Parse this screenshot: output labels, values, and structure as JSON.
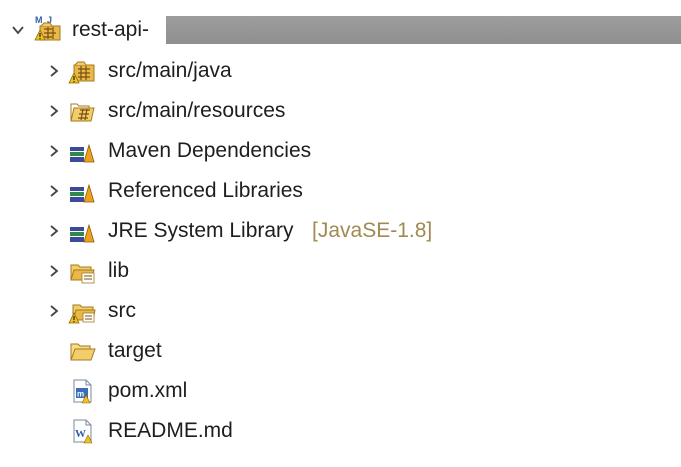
{
  "project": {
    "name": "rest-api-",
    "expanded": true
  },
  "items": [
    {
      "label": "src/main/java",
      "icon": "java-source-folder-icon",
      "expandable": true
    },
    {
      "label": "src/main/resources",
      "icon": "resource-folder-icon",
      "expandable": true
    },
    {
      "label": "Maven Dependencies",
      "icon": "library-icon",
      "expandable": true
    },
    {
      "label": "Referenced Libraries",
      "icon": "library-icon",
      "expandable": true
    },
    {
      "label": "JRE System Library",
      "decoration": "[JavaSE-1.8]",
      "icon": "library-icon",
      "expandable": true
    },
    {
      "label": "lib",
      "icon": "folder-icon",
      "expandable": true
    },
    {
      "label": "src",
      "icon": "folder-icon",
      "expandable": true
    },
    {
      "label": "target",
      "icon": "open-folder-icon",
      "expandable": false
    },
    {
      "label": "pom.xml",
      "icon": "xml-file-icon",
      "expandable": false
    },
    {
      "label": "README.md",
      "icon": "markdown-file-icon",
      "expandable": false
    }
  ],
  "colors": {
    "text": "#1e1e1e",
    "decoration": "#a08a52",
    "folder": "#e8b84a",
    "warning": "#f0c020"
  }
}
